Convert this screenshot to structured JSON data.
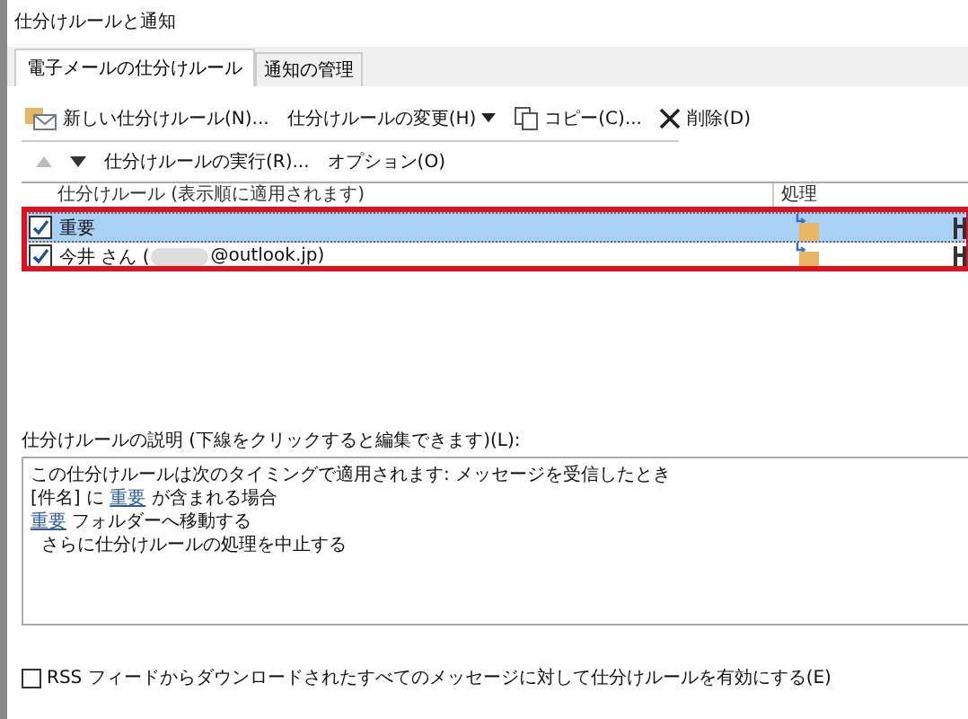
{
  "window": {
    "title": "仕分けルールと通知"
  },
  "tabs": [
    {
      "label": "電子メールの仕分けルール",
      "selected": true
    },
    {
      "label": "通知の管理",
      "selected": false
    }
  ],
  "toolbar": [
    {
      "kind": "new",
      "label": "新しい仕分けルール(N)..."
    },
    {
      "kind": "change",
      "label": "仕分けルールの変更(H)"
    },
    {
      "kind": "copy",
      "label": "コピー(C)..."
    },
    {
      "kind": "delete",
      "label": "削除(D)"
    }
  ],
  "toolbar_2": [
    {
      "kind": "up",
      "disabled": true
    },
    {
      "kind": "down",
      "disabled": false
    },
    {
      "kind": "text",
      "label": "仕分けルールの実行(R)..."
    },
    {
      "kind": "text",
      "label": "オプション(O)"
    }
  ],
  "rules_table": {
    "columns": [
      "仕分けルール (表示順に適用されます)",
      "処理"
    ],
    "rows": [
      {
        "name": "重要",
        "checked": true,
        "selected": true
      },
      {
        "name": "今井 さん (",
        "name_end": "@outlook.jp)",
        "checked": true,
        "selected": false
      }
    ]
  },
  "description": {
    "label": "仕分けルールの説明 (下線をクリックすると編集できます)(L):",
    "lines": [
      {
        "parts": [
          {
            "text": "この仕分けルールは次のタイミングで適用されます: メッセージを受信したとき"
          }
        ]
      },
      {
        "parts": [
          {
            "text": "[件名] に "
          },
          {
            "text": "重要",
            "link": true
          },
          {
            "text": " が含まれる場合"
          }
        ]
      },
      {
        "parts": [
          {
            "text": "重要",
            "link": true
          },
          {
            "text": " フォルダーへ移動する"
          }
        ]
      },
      {
        "indent": true,
        "parts": [
          {
            "text": "さらに仕分けルールの処理を中止する"
          }
        ]
      }
    ]
  },
  "rss_option": {
    "label": "RSS フィードからダウンロードされたすべてのメッセージに対して仕分けルールを有効にする(E)",
    "checked": false
  }
}
